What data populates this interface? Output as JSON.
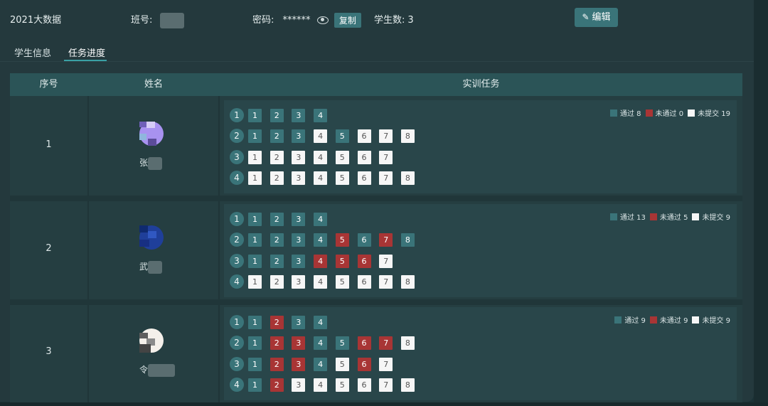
{
  "header": {
    "class_title": "2021大数据",
    "class_no_label": "班号:",
    "password_label": "密码:",
    "password_value": "******",
    "copy_label": "复制",
    "student_count_label": "学生数:",
    "student_count": "3",
    "edit_label": "编辑"
  },
  "tabs": [
    {
      "label": "学生信息",
      "active": false
    },
    {
      "label": "任务进度",
      "active": true
    }
  ],
  "table": {
    "columns": [
      "序号",
      "姓名",
      "实训任务"
    ]
  },
  "legend_labels": {
    "pass": "通过",
    "fail": "未通过",
    "none": "未提交"
  },
  "colors": {
    "pass": "#3a7479",
    "fail": "#a83535",
    "none": "#f6f6f6",
    "accent": "#3aa0a4"
  },
  "students": [
    {
      "index": "1",
      "name": "张",
      "counts": {
        "pass": "8",
        "fail": "0",
        "none": "19"
      },
      "groups": [
        {
          "no": "1",
          "tasks": [
            "p",
            "p",
            "p",
            "p"
          ]
        },
        {
          "no": "2",
          "tasks": [
            "p",
            "p",
            "p",
            "n",
            "p",
            "n",
            "n",
            "n"
          ]
        },
        {
          "no": "3",
          "tasks": [
            "n",
            "n",
            "n",
            "n",
            "n",
            "n",
            "n"
          ]
        },
        {
          "no": "4",
          "tasks": [
            "n",
            "n",
            "n",
            "n",
            "n",
            "n",
            "n",
            "n"
          ]
        }
      ]
    },
    {
      "index": "2",
      "name": "武",
      "counts": {
        "pass": "13",
        "fail": "5",
        "none": "9"
      },
      "groups": [
        {
          "no": "1",
          "tasks": [
            "p",
            "p",
            "p",
            "p"
          ]
        },
        {
          "no": "2",
          "tasks": [
            "p",
            "p",
            "p",
            "p",
            "f",
            "p",
            "f",
            "p"
          ]
        },
        {
          "no": "3",
          "tasks": [
            "p",
            "p",
            "p",
            "f",
            "f",
            "f",
            "n"
          ]
        },
        {
          "no": "4",
          "tasks": [
            "n",
            "n",
            "n",
            "n",
            "n",
            "n",
            "n",
            "n"
          ]
        }
      ]
    },
    {
      "index": "3",
      "name": "令",
      "counts": {
        "pass": "9",
        "fail": "9",
        "none": "9"
      },
      "groups": [
        {
          "no": "1",
          "tasks": [
            "p",
            "f",
            "p",
            "p"
          ]
        },
        {
          "no": "2",
          "tasks": [
            "p",
            "f",
            "f",
            "p",
            "p",
            "f",
            "f",
            "n"
          ]
        },
        {
          "no": "3",
          "tasks": [
            "p",
            "f",
            "f",
            "p",
            "n",
            "f",
            "n"
          ]
        },
        {
          "no": "4",
          "tasks": [
            "p",
            "f",
            "n",
            "n",
            "n",
            "n",
            "n",
            "n"
          ]
        }
      ]
    }
  ]
}
